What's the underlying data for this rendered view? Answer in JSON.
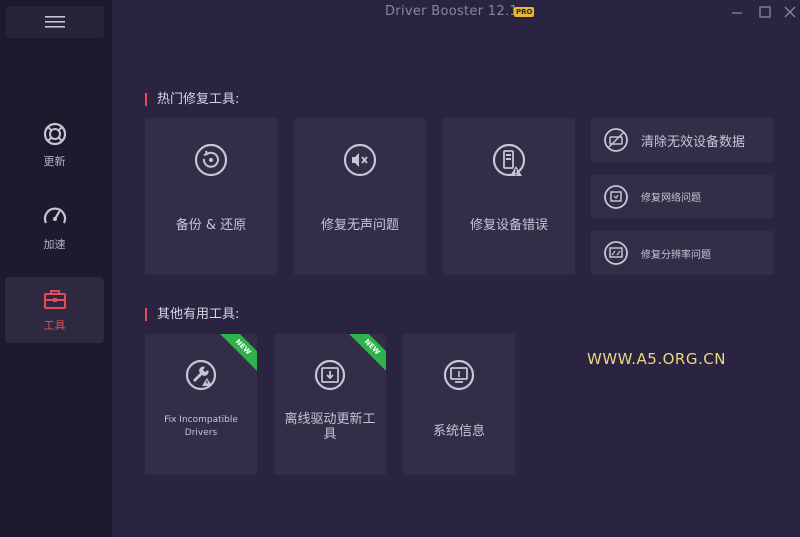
{
  "window": {
    "title": "Driver Booster 12.1",
    "pro_badge": "PRO"
  },
  "sidebar": {
    "items": [
      {
        "label": "更新",
        "icon": "update-icon"
      },
      {
        "label": "加速",
        "icon": "speedometer-icon"
      },
      {
        "label": "工具",
        "icon": "toolbox-icon",
        "active": true
      }
    ]
  },
  "hot_tools": {
    "title": "热门修复工具:",
    "tiles": [
      {
        "label": "备份 & 还原",
        "icon": "backup-restore-icon"
      },
      {
        "label": "修复无声问题",
        "icon": "mute-speaker-icon"
      },
      {
        "label": "修复设备错误",
        "icon": "device-warning-icon"
      }
    ],
    "small_tiles": [
      {
        "label": "清除无效设备数据",
        "icon": "clean-device-icon"
      },
      {
        "label": "修复网络问题",
        "icon": "network-icon"
      },
      {
        "label": "修复分辨率问题",
        "icon": "resolution-icon"
      }
    ]
  },
  "other_tools": {
    "title": "其他有用工具:",
    "tiles": [
      {
        "label": "Fix Incompatible Drivers",
        "icon": "wrench-warning-icon",
        "badge": "NEW"
      },
      {
        "label": "离线驱动更新工具",
        "icon": "offline-driver-icon",
        "badge": "NEW"
      },
      {
        "label": "系统信息",
        "icon": "system-info-icon"
      }
    ]
  },
  "watermark": "WWW.A5.ORG.CN",
  "colors": {
    "accent": "#e84a5a",
    "background": "#2a2440",
    "sidebar": "#1e1a2e",
    "tile": "#332d47",
    "new_badge": "#2db34a"
  }
}
